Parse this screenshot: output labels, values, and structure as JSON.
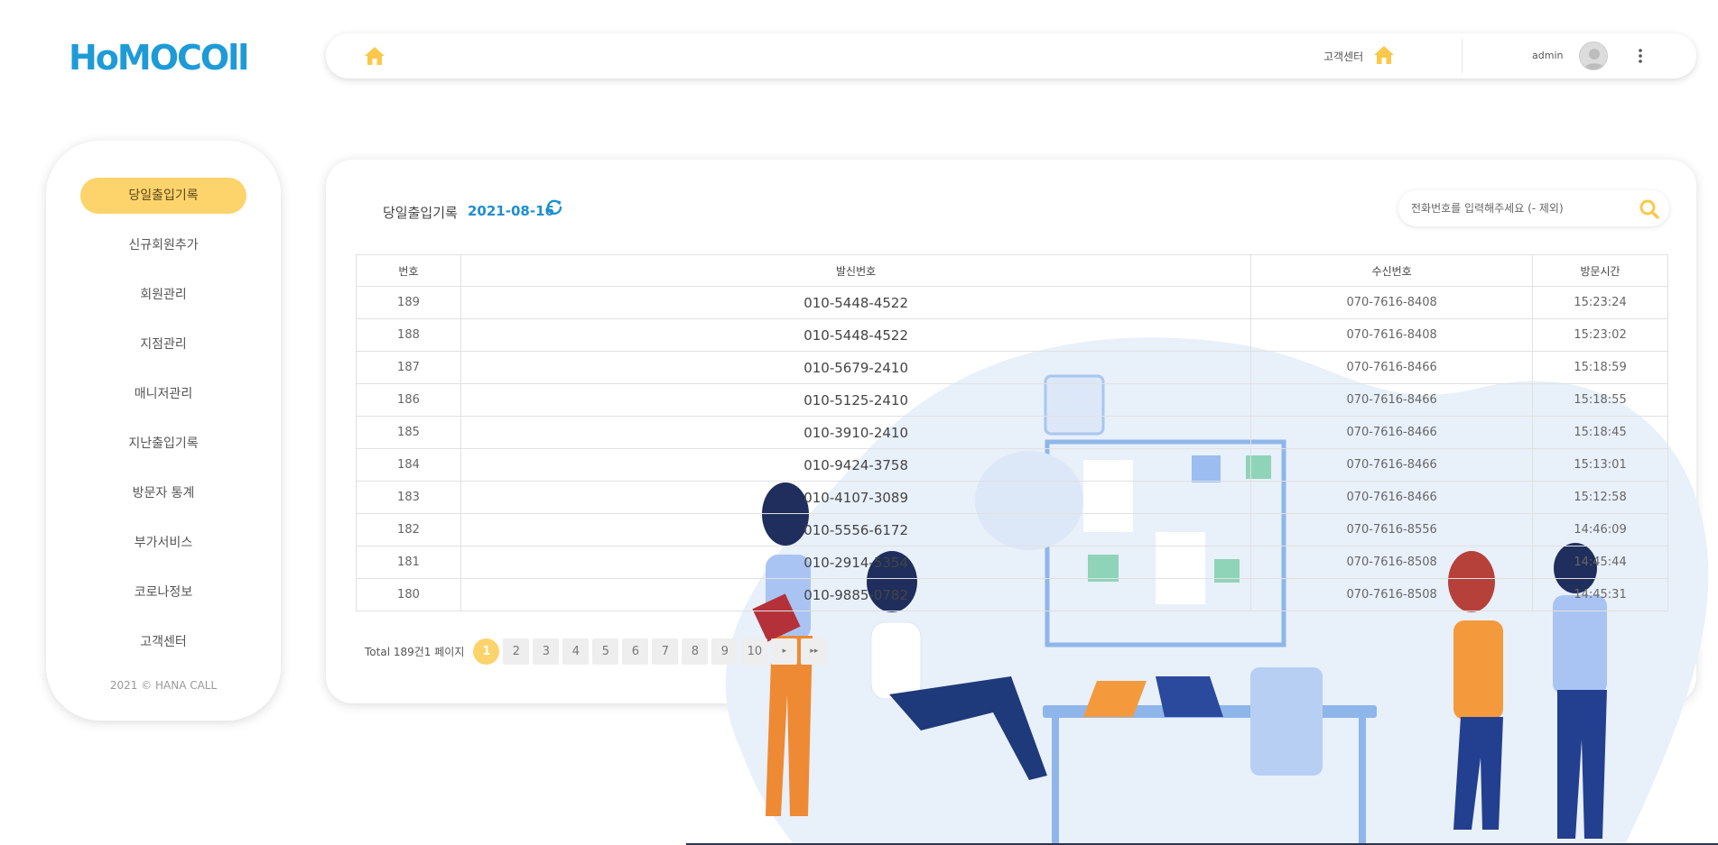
{
  "logo": {
    "text": "HoMOCOll"
  },
  "topbar": {
    "home_icon": "home-icon",
    "customer_center_label": "고객센터",
    "user_label": "admin",
    "menu_icon": "kebab-icon"
  },
  "sidebar": {
    "items": [
      {
        "label": "당일출입기록",
        "active": true
      },
      {
        "label": "신규회원추가"
      },
      {
        "label": "회원관리"
      },
      {
        "label": "지점관리"
      },
      {
        "label": "매니저관리"
      },
      {
        "label": "지난출입기록"
      },
      {
        "label": "방문자 통계"
      },
      {
        "label": "부가서비스"
      },
      {
        "label": "코로나정보"
      },
      {
        "label": "고객센터"
      }
    ],
    "footer": "2021 © HANA CALL"
  },
  "main": {
    "title": "당일출입기록",
    "date": "2021-08-16",
    "search_placeholder": "전화번호를 입력해주세요 (- 제외)",
    "table": {
      "headers": [
        "번호",
        "발신번호",
        "수신번호",
        "방문시간"
      ],
      "rows": [
        [
          "189",
          "010-5448-4522",
          "070-7616-8408",
          "15:23:24"
        ],
        [
          "188",
          "010-5448-4522",
          "070-7616-8408",
          "15:23:02"
        ],
        [
          "187",
          "010-5679-2410",
          "070-7616-8466",
          "15:18:59"
        ],
        [
          "186",
          "010-5125-2410",
          "070-7616-8466",
          "15:18:55"
        ],
        [
          "185",
          "010-3910-2410",
          "070-7616-8466",
          "15:18:45"
        ],
        [
          "184",
          "010-9424-3758",
          "070-7616-8466",
          "15:13:01"
        ],
        [
          "183",
          "010-4107-3089",
          "070-7616-8466",
          "15:12:58"
        ],
        [
          "182",
          "010-5556-6172",
          "070-7616-8556",
          "14:46:09"
        ],
        [
          "181",
          "010-2914-5354",
          "070-7616-8508",
          "14:45:44"
        ],
        [
          "180",
          "010-9885-0782",
          "070-7616-8508",
          "14:45:31"
        ]
      ]
    },
    "pagination": {
      "total_text": "Total 189건1 페이지",
      "pages": [
        "1",
        "2",
        "3",
        "4",
        "5",
        "6",
        "7",
        "8",
        "9",
        "10"
      ],
      "current": "1",
      "next": "▸",
      "last": "▸▸"
    }
  },
  "colors": {
    "accent_yellow": "#fdd36b",
    "brand_blue": "#1e9bd7",
    "date_blue": "#1e8fd0"
  }
}
